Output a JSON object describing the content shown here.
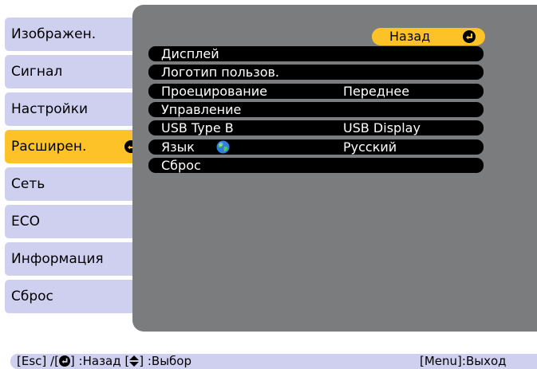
{
  "sidebar": {
    "items": [
      {
        "label": "Изображен."
      },
      {
        "label": "Сигнал"
      },
      {
        "label": "Настройки"
      },
      {
        "label": "Расширен."
      },
      {
        "label": "Сеть"
      },
      {
        "label": "ECO"
      },
      {
        "label": "Информация"
      },
      {
        "label": "Сброс"
      }
    ],
    "active_index": 3
  },
  "panel": {
    "back_label": "Назад",
    "rows": [
      {
        "label": "Дисплей",
        "value": ""
      },
      {
        "label": "Логотип пользов.",
        "value": ""
      },
      {
        "label": "Проецирование",
        "value": "Переднее"
      },
      {
        "label": "Управление",
        "value": ""
      },
      {
        "label": "USB Type B",
        "value": "USB Display"
      },
      {
        "label": "Язык",
        "value": "Русский",
        "icon": "globe-icon"
      },
      {
        "label": "Сброс",
        "value": ""
      }
    ]
  },
  "footer": {
    "left_hint": "[Esc] /[   ] :Назад  [  ] :Выбор",
    "left_parts": [
      "[Esc] /[",
      "] :Назад  [",
      "] :Выбор"
    ],
    "right_hint": "[Menu]:Выход"
  },
  "colors": {
    "background": "#ffffff",
    "sidebar_item": "#cfd0ef",
    "active_item": "#fcc227",
    "panel": "#7b7c7e",
    "row": "#000000",
    "row_text": "#ffffff"
  }
}
